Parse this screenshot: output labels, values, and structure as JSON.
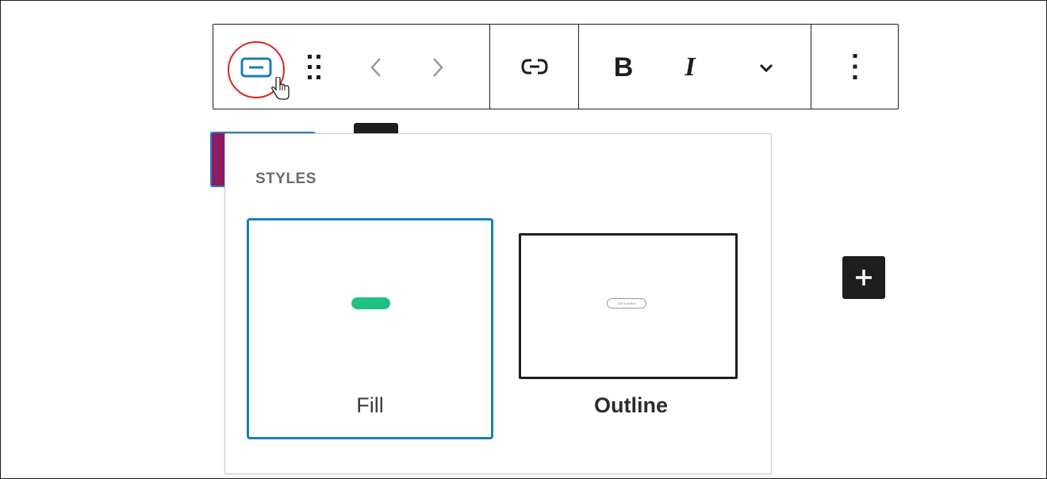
{
  "toolbar": {
    "button_block_icon": "button-block-icon",
    "drag_icon": "drag-handle-icon",
    "move_left_icon": "chevron-left-icon",
    "move_right_icon": "chevron-right-icon",
    "link_icon": "link-icon",
    "bold_label": "B",
    "italic_label": "I",
    "more_formatting_icon": "chevron-down-icon",
    "options_icon": "more-vertical-icon"
  },
  "popover": {
    "heading": "STYLES",
    "options": [
      {
        "label": "Fill",
        "selected": true
      },
      {
        "label": "Outline",
        "selected": false
      }
    ],
    "outline_preview_text": "Call to Action"
  },
  "add_block_icon": "plus-icon",
  "colors": {
    "accent": "#1a7fb5",
    "fill_preview": "#1ec27f",
    "block_background": "#8b1c62",
    "highlight_ring": "#e02424",
    "dark": "#1e1e1e"
  }
}
